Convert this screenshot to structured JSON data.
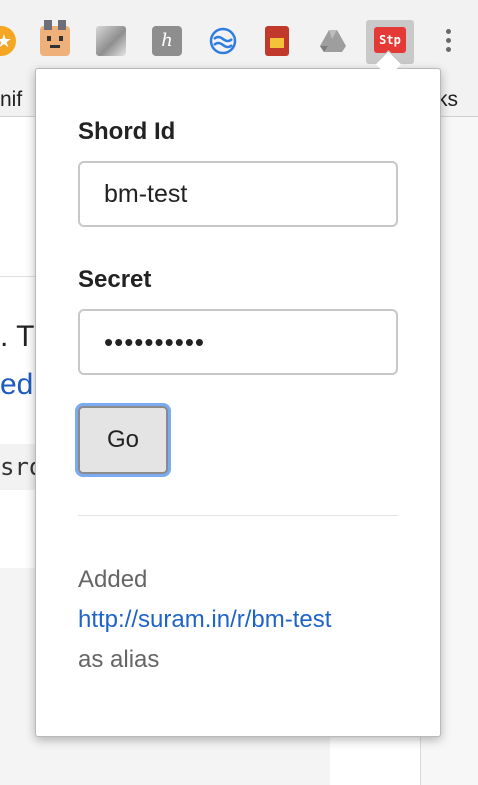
{
  "toolbar": {
    "extensions": [
      {
        "icon": "star-icon"
      },
      {
        "icon": "face-icon"
      },
      {
        "icon": "photo-icon"
      },
      {
        "icon": "h-icon",
        "glyph": "h"
      },
      {
        "icon": "wave-icon"
      },
      {
        "icon": "card-icon"
      },
      {
        "icon": "drive-icon"
      },
      {
        "icon": "stp-icon",
        "glyph": "Stp"
      }
    ],
    "menu_icon": "more-vertical-icon"
  },
  "bookmarks": {
    "left_fragment": "nif",
    "right_fragment": "ks"
  },
  "background_page": {
    "text_fragment": ". T",
    "link_fragment": "edit",
    "code_fragment": "sro"
  },
  "popup": {
    "shord_label": "Shord Id",
    "shord_value": "bm-test",
    "secret_label": "Secret",
    "secret_masked": "••••••••••",
    "go_label": "Go",
    "result_prefix": "Added",
    "result_link": "http://suram.in/r/bm-test",
    "result_suffix": "as alias"
  },
  "colors": {
    "link": "#1e64c8",
    "focus_ring": "#7aaaf0",
    "stp_red": "#e53935"
  }
}
